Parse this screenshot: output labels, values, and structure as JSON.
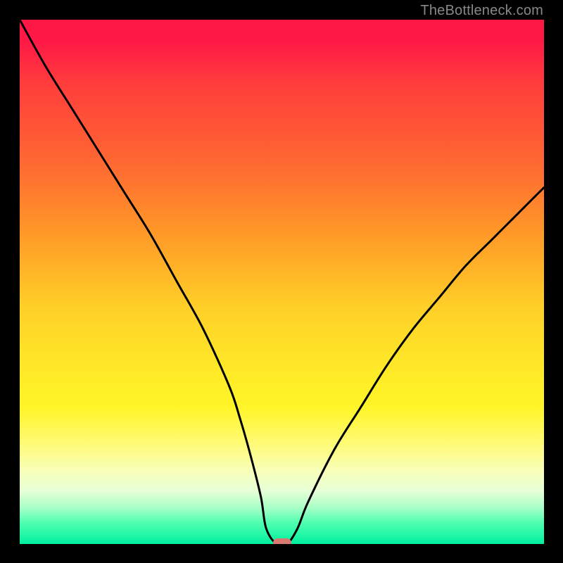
{
  "watermark": "TheBottleneck.com",
  "colors": {
    "black": "#000000",
    "gradient_top": "#ff1846",
    "gradient_mid": "#ffe628",
    "gradient_bottom": "#00f0a0",
    "marker": "#d87a72",
    "watermark": "#888888"
  },
  "chart_data": {
    "type": "line",
    "title": "",
    "xlabel": "",
    "ylabel": "",
    "xlim": [
      0,
      100
    ],
    "ylim": [
      0,
      100
    ],
    "x": [
      0,
      5,
      10,
      15,
      20,
      25,
      30,
      35,
      40,
      42,
      44,
      46,
      47,
      49,
      51,
      53,
      55,
      60,
      65,
      70,
      75,
      80,
      85,
      90,
      95,
      100
    ],
    "values": [
      100,
      91,
      83,
      75,
      67,
      59,
      50,
      41,
      30,
      24,
      17,
      9,
      3,
      0,
      0,
      3,
      8,
      18,
      26,
      34,
      41,
      47,
      53,
      58,
      63,
      68
    ],
    "minimum": {
      "x": 50,
      "y": 0
    },
    "marker": {
      "x": 50,
      "y": 0,
      "color": "#d87a72"
    }
  }
}
